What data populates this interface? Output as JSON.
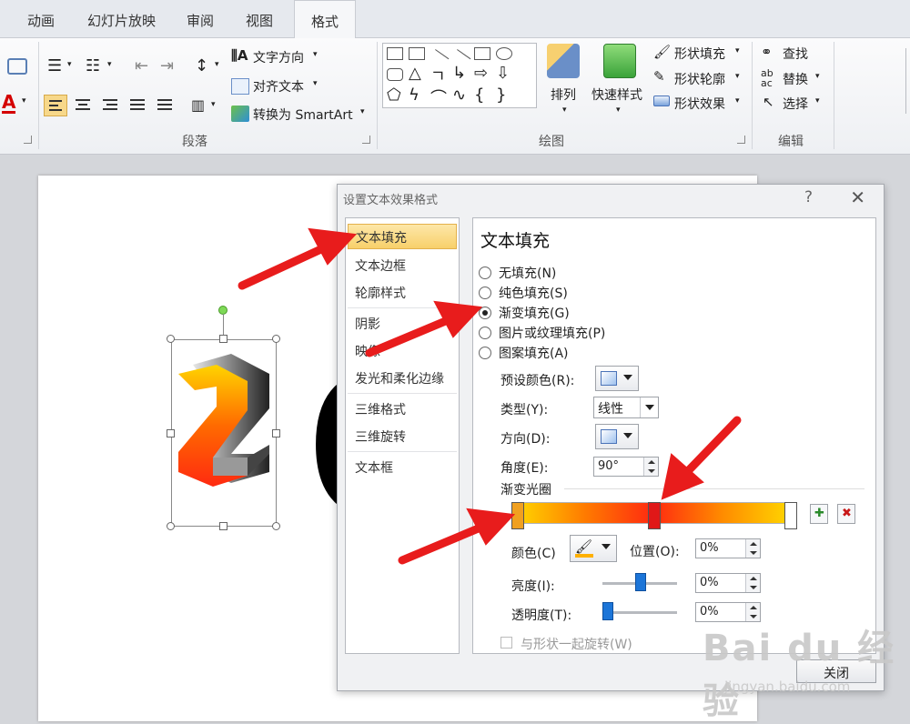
{
  "ribbon_tabs": [
    "动画",
    "幻灯片放映",
    "审阅",
    "视图",
    "格式"
  ],
  "ribbon": {
    "text_direction": "文字方向",
    "align_text": "对齐文本",
    "convert_smartart": "转换为 SmartArt",
    "group_paragraph": "段落",
    "arrange": "排列",
    "quick_styles": "快速样式",
    "shape_fill": "形状填充",
    "shape_outline": "形状轮廓",
    "shape_effects": "形状效果",
    "group_drawing": "绘图",
    "find": "查找",
    "replace": "替换",
    "select": "选择",
    "group_editing": "编辑",
    "font_color_glyph": "A"
  },
  "slide": {
    "digit_zero": "0"
  },
  "dialog": {
    "title": "设置文本效果格式",
    "help": "?",
    "close_x": "✕",
    "nav": [
      "文本填充",
      "文本边框",
      "轮廓样式",
      "阴影",
      "映像",
      "发光和柔化边缘",
      "三维格式",
      "三维旋转",
      "文本框"
    ],
    "panel_title": "文本填充",
    "fill_options": [
      "无填充(N)",
      "纯色填充(S)",
      "渐变填充(G)",
      "图片或纹理填充(P)",
      "图案填充(A)"
    ],
    "selected_fill": "渐变填充(G)",
    "preset_color_label": "预设颜色(R):",
    "type_label": "类型(Y):",
    "type_value": "线性",
    "direction_label": "方向(D):",
    "angle_label": "角度(E):",
    "angle_value": "90°",
    "gradient_stops_label": "渐变光圈",
    "color_label": "颜色(C)",
    "position_label": "位置(O):",
    "position_value": "0%",
    "brightness_label": "亮度(I):",
    "brightness_value": "0%",
    "transparency_label": "透明度(T):",
    "transparency_value": "0%",
    "rotate_with_shape": "与形状一起旋转(W)",
    "close_button": "关闭"
  },
  "watermark": {
    "brand": "Bai du 经验",
    "url": "jingyan.baidu.com"
  },
  "colors": {
    "arrow": "#e81c1c",
    "gradient_start": "#ffd400",
    "gradient_mid": "#ff2a10",
    "selection_highlight": "#f8d06a"
  }
}
